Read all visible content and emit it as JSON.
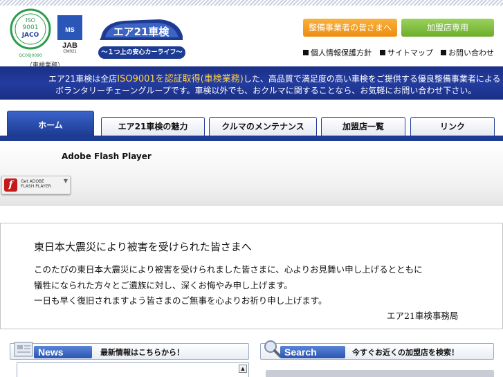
{
  "header": {
    "iso_seal": {
      "top": "ISO",
      "mid": "9001",
      "org": "JACO",
      "code": "QC06J0090"
    },
    "jab": {
      "logo": "MS",
      "name": "JAB",
      "code": "CM021"
    },
    "cert_note": "（車検業務）",
    "brand": {
      "logo_text": "エア21車検",
      "tagline": "～１つ上の安心カーライフ～"
    },
    "buttons": {
      "maintainers": "整備事業者の皆さまへ",
      "members": "加盟店専用"
    },
    "util_links": [
      "個人情報保護方針",
      "サイトマップ",
      "お問い合わせ"
    ]
  },
  "banner": {
    "line1_pre": "エア21車検は全店",
    "line1_highlight": "ISO9001を認証取得(車検業務)",
    "line1_post": "した、高品質で満足度の高い車検をご提供する優良整備事業者による",
    "line2": "ボランタリーチェーングループです。車検以外でも、おクルマに関することなら、お気軽にお問い合わせ下さい。"
  },
  "nav": {
    "tabs": [
      "ホーム",
      "エア21車検の魅力",
      "クルマのメンテナンス",
      "加盟店一覧",
      "リンク"
    ]
  },
  "flash": {
    "title": "Adobe Flash Player",
    "badge_get": "Get ADOBE",
    "badge_name": "FLASH PLAYER",
    "badge_icon": "f"
  },
  "notice": {
    "title": "東日本大震災により被害を受けられた皆さまへ",
    "lines": [
      "このたびの東日本大震災により被害を受けられました皆さまに、心よりお見舞い申し上げるとともに",
      "犠牲になられた方々とご遺族に対し、深くお悔やみ申し上げます。",
      "一日も早く復旧されますよう皆さまのご無事を心よりお祈り申し上げます。"
    ],
    "signature": "エア21車検事務局"
  },
  "news": {
    "label": "News",
    "desc": "最新情報はこちらから！",
    "icon": "newspaper-icon"
  },
  "search": {
    "label": "Search",
    "desc": "今すぐお近くの加盟店を検索！",
    "icon": "magnifier-icon"
  },
  "colors": {
    "navy": "#1d3b93",
    "orange": "#ee8d10",
    "green": "#6cae2a",
    "highlight": "#ffd14a"
  }
}
